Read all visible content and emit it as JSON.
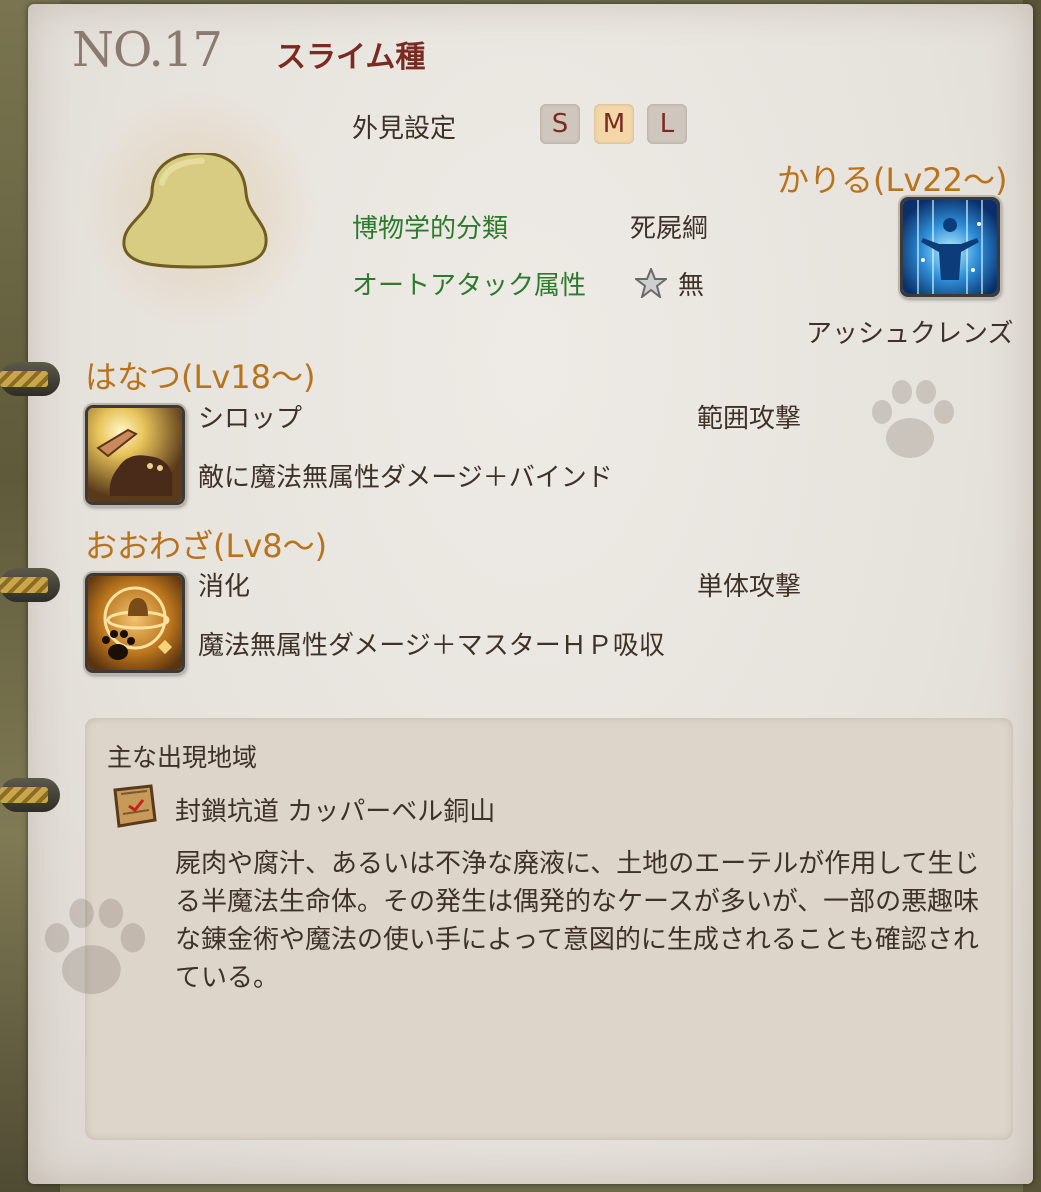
{
  "header": {
    "number": "NO.17",
    "species": "スライム種"
  },
  "appearance": {
    "label": "外見設定",
    "sizes": [
      "S",
      "M",
      "L"
    ],
    "selected": "M"
  },
  "info": {
    "taxonomy_label": "博物学的分類",
    "taxonomy_value": "死屍綱",
    "auto_attack_label": "オートアタック属性",
    "auto_attack_value": "無"
  },
  "kariru": {
    "heading": "かりる(Lv22～)",
    "skill_name": "アッシュクレンズ"
  },
  "hanatsu": {
    "heading": "はなつ(Lv18～)",
    "skill_name": "シロップ",
    "skill_type": "範囲攻撃",
    "skill_desc": "敵に魔法無属性ダメージ＋バインド"
  },
  "oowaza": {
    "heading": "おおわざ(Lv8～)",
    "skill_name": "消化",
    "skill_type": "単体攻撃",
    "skill_desc": "魔法無属性ダメージ＋マスターＨＰ吸収"
  },
  "region": {
    "title": "主な出現地域",
    "location": "封鎖坑道 カッパーベル銅山",
    "description": "屍肉や腐汁、あるいは不浄な廃液に、土地のエーテルが作用して生じる半魔法生命体。その発生は偶発的なケースが多いが、一部の悪趣味な錬金術や魔法の使い手によって意図的に生成されることも確認されている。"
  },
  "colors": {
    "accent": "#b8731c",
    "green": "#2d7a2d",
    "title": "#7a2a20",
    "text": "#3e3228"
  }
}
